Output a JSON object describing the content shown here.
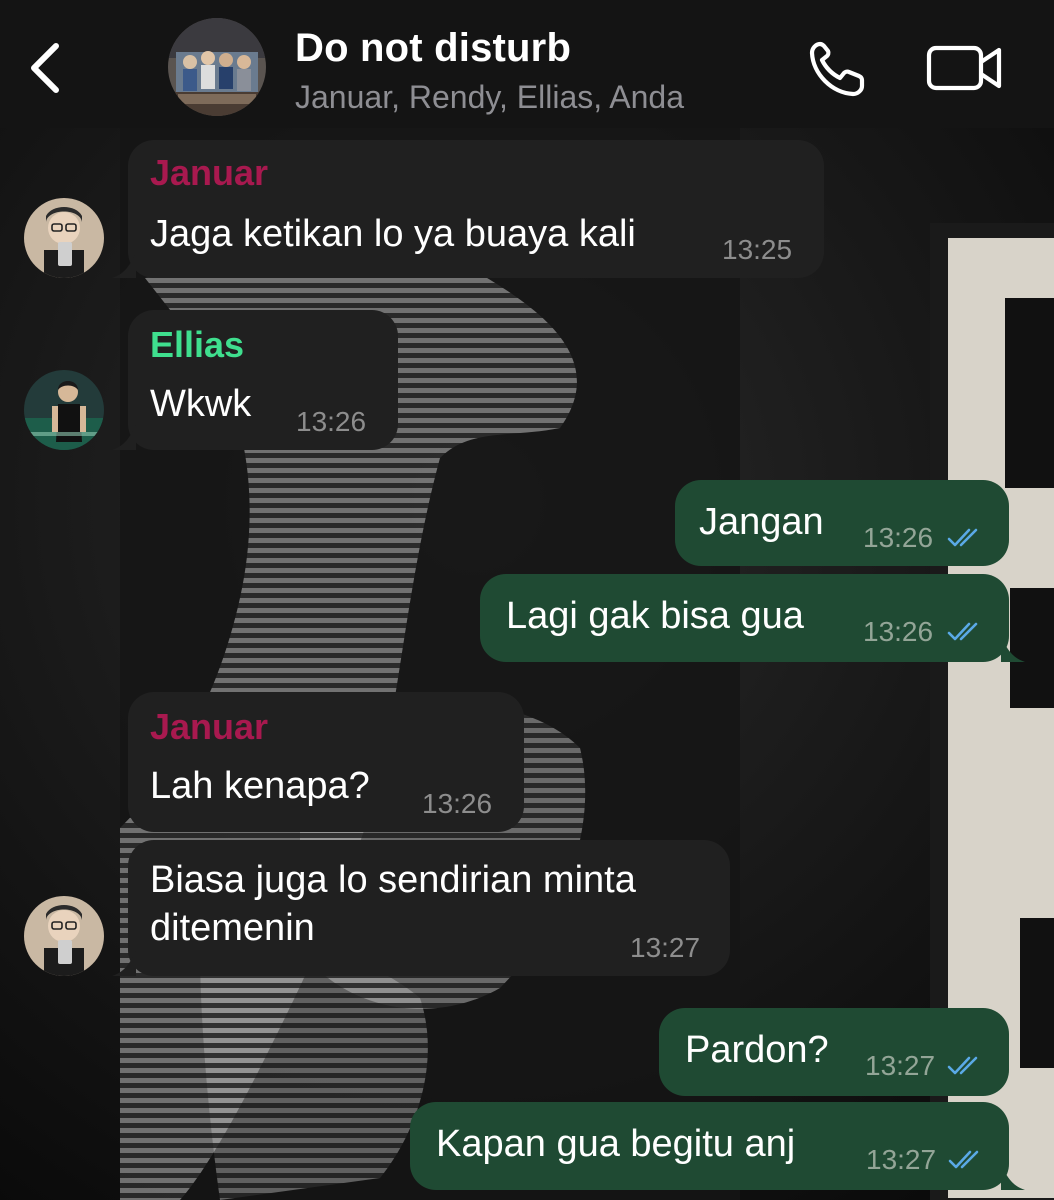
{
  "header": {
    "title": "Do not disturb",
    "subtitle": "Januar, Rendy, Ellias, Anda",
    "back_icon": "chevron-left-icon",
    "call_icon": "phone-icon",
    "video_icon": "video-camera-icon"
  },
  "colors": {
    "header_bg": "#141414",
    "incoming_bubble": "#202020",
    "outgoing_bubble": "#1f4a33",
    "januar_name": "#a8194f",
    "ellias_name": "#3fdf8e",
    "read_ticks": "#5aa9e6"
  },
  "messages": [
    {
      "direction": "incoming",
      "sender": "Januar",
      "text": "Jaga ketikan lo ya buaya kali",
      "time": "13:25"
    },
    {
      "direction": "incoming",
      "sender": "Ellias",
      "text": "Wkwk",
      "time": "13:26"
    },
    {
      "direction": "outgoing",
      "text": "Jangan",
      "time": "13:26",
      "status": "read"
    },
    {
      "direction": "outgoing",
      "text": "Lagi gak bisa gua",
      "time": "13:26",
      "status": "read"
    },
    {
      "direction": "incoming",
      "sender": "Januar",
      "text": "Lah kenapa?",
      "time": "13:26"
    },
    {
      "direction": "incoming",
      "text_line1": "Biasa juga lo sendirian minta",
      "text_line2": "ditemenin",
      "time": "13:27"
    },
    {
      "direction": "outgoing",
      "text": "Pardon?",
      "time": "13:27",
      "status": "read"
    },
    {
      "direction": "outgoing",
      "text": "Kapan gua begitu anj",
      "time": "13:27",
      "status": "read"
    }
  ]
}
